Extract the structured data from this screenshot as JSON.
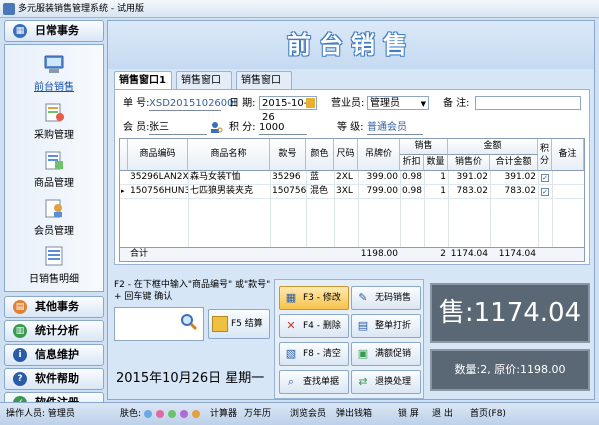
{
  "window": {
    "title": "多元服装销售管理系统 - 试用版"
  },
  "nav": {
    "daily": "日常事务",
    "items": [
      {
        "label": "前台销售",
        "active": true
      },
      {
        "label": "采购管理"
      },
      {
        "label": "商品管理"
      },
      {
        "label": "会员管理"
      },
      {
        "label": "日销售明细"
      }
    ],
    "sections": [
      "其他事务",
      "统计分析",
      "信息维护",
      "软件帮助",
      "软件注册"
    ]
  },
  "banner": "前台销售",
  "tabs": [
    "销售窗口1",
    "销售窗口2",
    "销售窗口3"
  ],
  "form": {
    "order_no_label": "单 号:",
    "order_no": "XSD2015102600l",
    "date_label": "日 期:",
    "date": "2015-10-26",
    "clerk_label": "营业员:",
    "clerk": "管理员",
    "note_label": "备 注:",
    "note": "",
    "member_label": "会 员:",
    "member": "张三",
    "points_label": "积 分:",
    "points": "1000",
    "level_label": "等 级:",
    "level": "普通会员"
  },
  "grid": {
    "headers": {
      "code": "商品编码",
      "name": "商品名称",
      "style": "款号",
      "color": "颜色",
      "size": "尺码",
      "tag_price": "吊牌价",
      "sale_group": "销售",
      "discount": "折扣",
      "qty": "数量",
      "amount_group": "金额",
      "price": "销售价",
      "subtotal": "合计金额",
      "points": "积分",
      "remark": "备注"
    },
    "rows": [
      {
        "code": "35296LAN2XL",
        "name": "森马女装T恤",
        "style": "35296",
        "color": "蓝",
        "size": "2XL",
        "tag_price": "399.00",
        "discount": "0.98",
        "qty": "1",
        "price": "391.02",
        "subtotal": "391.02",
        "points": "✓"
      },
      {
        "code": "150756HUN3XL",
        "name": "七匹狼男装夹克",
        "style": "150756",
        "color": "混色",
        "size": "3XL",
        "tag_price": "799.00",
        "discount": "0.98",
        "qty": "1",
        "price": "783.02",
        "subtotal": "783.02",
        "points": "✓"
      }
    ],
    "total": {
      "label": "合计",
      "tag_price": "1198.00",
      "qty": "2",
      "price": "1174.04",
      "subtotal": "1174.04"
    }
  },
  "hint": "F2 - 在下框中输入\"商品编号\" 或\"款号\" + 回车键 确认",
  "settle_button": "F5 结算",
  "date_display": "2015年10月26日 星期一",
  "actions": [
    {
      "label": "F3 - 修改",
      "icon": "grid-edit-icon"
    },
    {
      "label": "无码销售",
      "icon": "pencil-icon"
    },
    {
      "label": "F4 - 删除",
      "icon": "grid-delete-icon"
    },
    {
      "label": "整单打折",
      "icon": "document-discount-icon"
    },
    {
      "label": "F8 - 清空",
      "icon": "grid-clear-icon"
    },
    {
      "label": "满额促销",
      "icon": "promotion-icon"
    },
    {
      "label": "查找单据",
      "icon": "search-doc-icon"
    },
    {
      "label": "退换处理",
      "icon": "exchange-icon"
    }
  ],
  "summary": {
    "big": "售:1174.04",
    "small": "数量:2, 原价:1198.00"
  },
  "status": {
    "operator": "操作人员: 管理员",
    "skin_label": "肤色:",
    "skin_colors": [
      "#6aa9e6",
      "#e36aa0",
      "#6cc36a",
      "#b06ad8",
      "#e6a040"
    ],
    "links": [
      "计算器",
      "万年历",
      "浏览会员",
      "弹出钱箱",
      "锁 屏",
      "退 出",
      "首页(F8)"
    ]
  }
}
